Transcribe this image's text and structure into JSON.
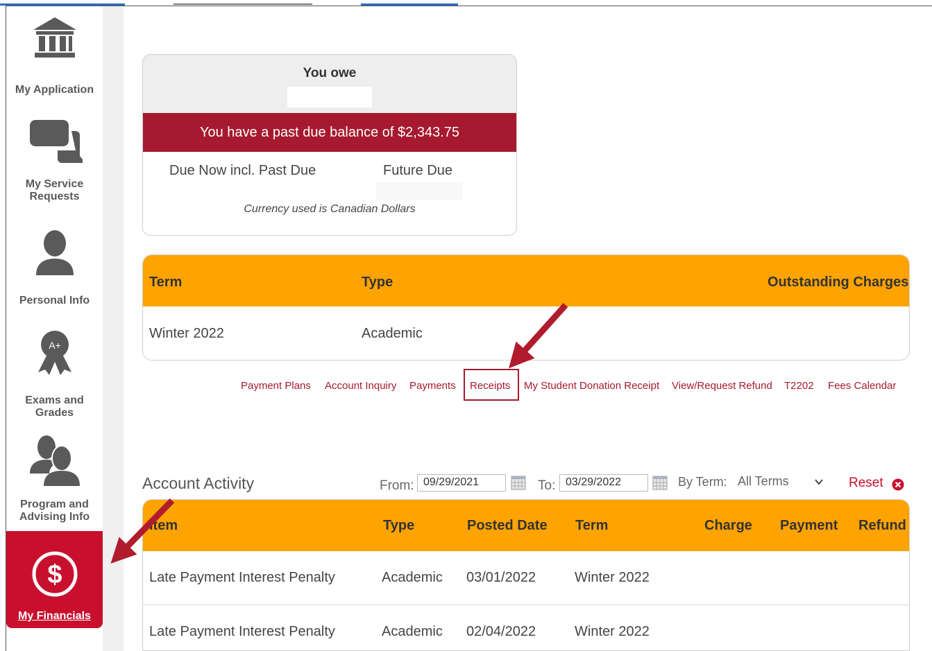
{
  "sidebar": {
    "items": [
      {
        "label": "My Application",
        "icon": "bank-icon"
      },
      {
        "label": "My Service Requests",
        "label_line1": "My Service",
        "label_line2": "Requests",
        "icon": "chat-bubbles-icon"
      },
      {
        "label": "Personal Info",
        "icon": "person-icon"
      },
      {
        "label": "Exams and Grades",
        "label_line1": "Exams and",
        "label_line2": "Grades",
        "icon": "award-ribbon-icon"
      },
      {
        "label": "Program and Advising Info",
        "label_line1": "Program and",
        "label_line2": "Advising Info",
        "icon": "two-people-icon"
      },
      {
        "label": "My Financials",
        "icon": "dollar-circle-icon",
        "active": true
      }
    ]
  },
  "balance": {
    "you_owe": "You owe",
    "past_due_message": "You have a past due balance of $2,343.75",
    "due_now_label": "Due Now incl. Past Due",
    "future_due_label": "Future Due",
    "currency_note": "Currency used is Canadian Dollars"
  },
  "charges": {
    "headers": {
      "term": "Term",
      "type": "Type",
      "outstanding": "Outstanding Charges"
    },
    "rows": [
      {
        "term": "Winter 2022",
        "type": "Academic"
      }
    ]
  },
  "links": [
    "Payment Plans",
    "Account Inquiry",
    "Payments",
    "Receipts",
    "My Student Donation Receipt",
    "View/Request Refund",
    "T2202",
    "Fees Calendar"
  ],
  "activity": {
    "title": "Account Activity",
    "from_label": "From:",
    "from_value": "09/29/2021",
    "to_label": "To:",
    "to_value": "03/29/2022",
    "by_term_label": "By Term:",
    "term_value": "All Terms",
    "reset_label": "Reset",
    "headers": {
      "item": "Item",
      "type": "Type",
      "posted_date": "Posted Date",
      "term": "Term",
      "charge": "Charge",
      "payment": "Payment",
      "refund": "Refund"
    },
    "rows": [
      {
        "item": "Late Payment Interest Penalty",
        "type": "Academic",
        "posted_date": "03/01/2022",
        "term": "Winter 2022"
      },
      {
        "item": "Late Payment Interest Penalty",
        "type": "Academic",
        "posted_date": "02/04/2022",
        "term": "Winter 2022"
      }
    ]
  },
  "colors": {
    "brand_red": "#c8102e",
    "dark_red": "#a6192e",
    "table_header": "#ffa300",
    "arrow": "#b01c2e"
  }
}
